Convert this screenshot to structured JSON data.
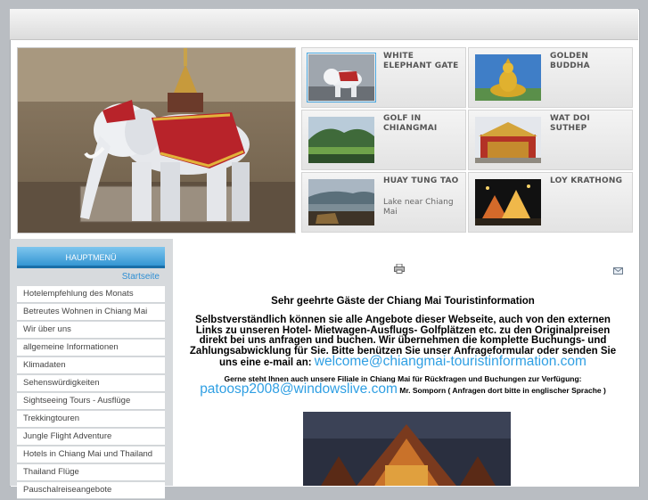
{
  "featured": [
    {
      "title": "WHITE ELEPHANT GATE",
      "subtitle": ""
    },
    {
      "title": "GOLDEN BUDDHA",
      "subtitle": ""
    },
    {
      "title": "GOLF IN CHIANGMAI",
      "subtitle": ""
    },
    {
      "title": "WAT DOI SUTHEP",
      "subtitle": ""
    },
    {
      "title": "HUAY TUNG TAO",
      "subtitle": "Lake near Chiang Mai"
    },
    {
      "title": "LOY KRATHONG",
      "subtitle": ""
    }
  ],
  "menu": {
    "header": "HAUPTMENÜ",
    "home": "Startseite",
    "items": [
      "Hotelempfehlung des Monats",
      "Betreutes Wohnen in Chiang Mai",
      "Wir über uns",
      "allgemeine Informationen",
      "Klimadaten",
      "Sehenswürdigkeiten",
      "Sightseeing Tours - Ausflüge",
      "Trekkingtouren",
      "Jungle Flight Adventure",
      "Hotels in Chiang Mai und Thailand",
      "Thailand Flüge",
      "Pauschalreiseangebote"
    ]
  },
  "content": {
    "title": "Sehr geehrte Gäste der Chiang Mai Touristinformation",
    "body": "Selbstverständlich können sie alle Angebote dieser Webseite, auch von den externen Links zu unseren Hotel- Mietwagen-Ausflugs- Golfplätzen etc. zu den Originalpreisen direkt bei uns anfragen und buchen. Wir übernehmen die komplette Buchungs- und Zahlungsabwicklung für Sie. Bitte benützen Sie unser Anfrageformular oder senden Sie uns eine e-mail an:",
    "email1": "welcome@chiangmai-touristinformation.com",
    "note_before": "Gerne steht Ihnen auch unsere Filiale in Chiang Mai für Rückfragen und Buchungen zur Verfügung:",
    "email2": "patoosp2008@windowslive.com",
    "note_after": "Mr. Somporn ( Anfragen dort bitte in englischer Sprache )"
  },
  "icons": {
    "print": "printer-icon",
    "email": "email-icon"
  },
  "colors": {
    "accent": "#2f8fd3",
    "link": "#2f9fe3",
    "menu_header": "#2a8fcf"
  }
}
